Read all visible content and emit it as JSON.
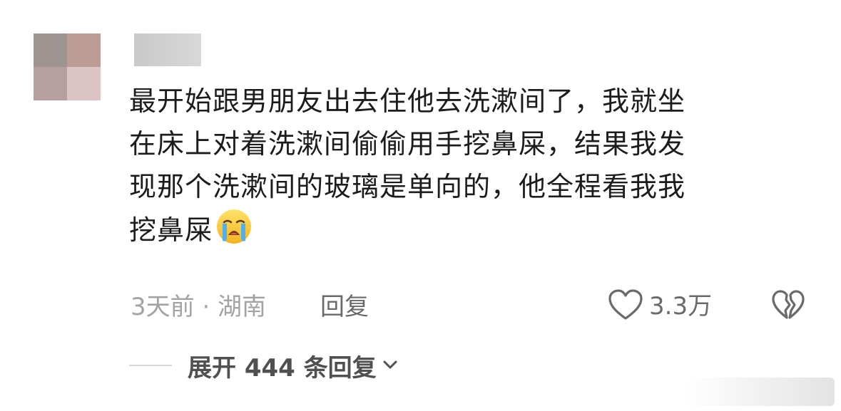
{
  "comment": {
    "lines": [
      "最开始跟男朋友出去住他去洗漱间了，我就坐",
      "在床上对着洗漱间偷偷用手挖鼻屎，结果我发",
      "现那个洗漱间的玻璃是单向的，他全程看我我",
      "挖鼻屎"
    ],
    "emoji": "loudly-crying-face"
  },
  "meta": {
    "time_location": "3天前 · 湖南",
    "reply_label": "回复"
  },
  "actions": {
    "like_count": "3.3万",
    "like_icon": "heart-outline-icon",
    "dislike_icon": "broken-heart-icon"
  },
  "expand": {
    "label": "展开 444 条回复"
  },
  "colors": {
    "text": "#1c1c1c",
    "meta": "#a3a3a3",
    "action": "#6a6a6a"
  }
}
